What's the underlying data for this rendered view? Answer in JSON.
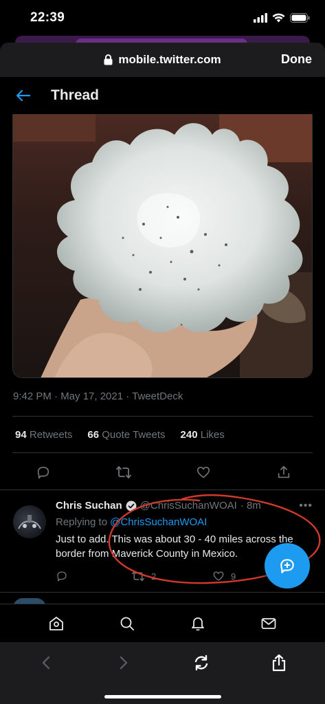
{
  "status": {
    "time": "22:39"
  },
  "browser": {
    "url": "mobile.twitter.com",
    "done_label": "Done"
  },
  "header": {
    "title": "Thread"
  },
  "tweet": {
    "meta": "9:42 PM · May 17, 2021 · TweetDeck",
    "stats": [
      {
        "count": "94",
        "label": "Retweets"
      },
      {
        "count": "66",
        "label": "Quote Tweets"
      },
      {
        "count": "240",
        "label": "Likes"
      }
    ]
  },
  "reply": {
    "name": "Chris Suchan",
    "handle": "@ChrisSuchanWOAI",
    "time": "· 8m",
    "replying_prefix": "Replying to",
    "replying_to": "@ChrisSuchanWOAI",
    "text": "Just to add.  This was about 30 - 40 miles across the border from Maverick County in Mexico.",
    "retweets": "2",
    "likes": "9"
  },
  "colors": {
    "accent": "#1d9bf0",
    "muted": "#71767b",
    "annotation": "#d0392b"
  },
  "icons": {
    "back": "back-arrow-icon",
    "lock": "lock-icon",
    "reply": "reply-icon",
    "retweet": "retweet-icon",
    "like": "heart-icon",
    "share": "share-icon",
    "compose": "compose-icon",
    "home": "home-icon",
    "search": "search-icon",
    "notifications": "bell-icon",
    "messages": "mail-icon"
  }
}
